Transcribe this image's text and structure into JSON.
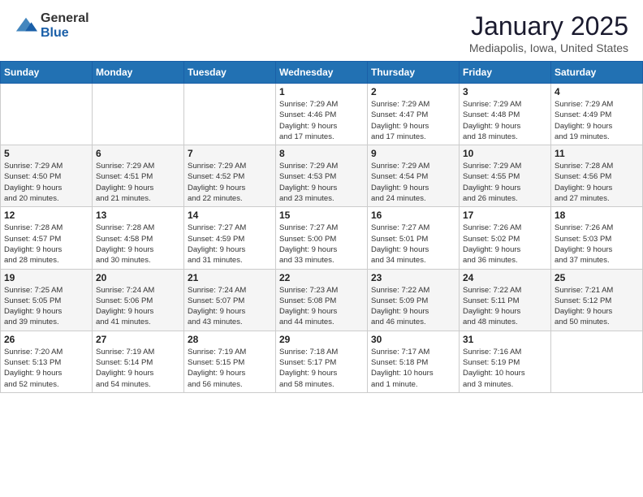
{
  "logo": {
    "general": "General",
    "blue": "Blue"
  },
  "header": {
    "month": "January 2025",
    "location": "Mediapolis, Iowa, United States"
  },
  "weekdays": [
    "Sunday",
    "Monday",
    "Tuesday",
    "Wednesday",
    "Thursday",
    "Friday",
    "Saturday"
  ],
  "weeks": [
    [
      {
        "day": "",
        "info": ""
      },
      {
        "day": "",
        "info": ""
      },
      {
        "day": "",
        "info": ""
      },
      {
        "day": "1",
        "info": "Sunrise: 7:29 AM\nSunset: 4:46 PM\nDaylight: 9 hours\nand 17 minutes."
      },
      {
        "day": "2",
        "info": "Sunrise: 7:29 AM\nSunset: 4:47 PM\nDaylight: 9 hours\nand 17 minutes."
      },
      {
        "day": "3",
        "info": "Sunrise: 7:29 AM\nSunset: 4:48 PM\nDaylight: 9 hours\nand 18 minutes."
      },
      {
        "day": "4",
        "info": "Sunrise: 7:29 AM\nSunset: 4:49 PM\nDaylight: 9 hours\nand 19 minutes."
      }
    ],
    [
      {
        "day": "5",
        "info": "Sunrise: 7:29 AM\nSunset: 4:50 PM\nDaylight: 9 hours\nand 20 minutes."
      },
      {
        "day": "6",
        "info": "Sunrise: 7:29 AM\nSunset: 4:51 PM\nDaylight: 9 hours\nand 21 minutes."
      },
      {
        "day": "7",
        "info": "Sunrise: 7:29 AM\nSunset: 4:52 PM\nDaylight: 9 hours\nand 22 minutes."
      },
      {
        "day": "8",
        "info": "Sunrise: 7:29 AM\nSunset: 4:53 PM\nDaylight: 9 hours\nand 23 minutes."
      },
      {
        "day": "9",
        "info": "Sunrise: 7:29 AM\nSunset: 4:54 PM\nDaylight: 9 hours\nand 24 minutes."
      },
      {
        "day": "10",
        "info": "Sunrise: 7:29 AM\nSunset: 4:55 PM\nDaylight: 9 hours\nand 26 minutes."
      },
      {
        "day": "11",
        "info": "Sunrise: 7:28 AM\nSunset: 4:56 PM\nDaylight: 9 hours\nand 27 minutes."
      }
    ],
    [
      {
        "day": "12",
        "info": "Sunrise: 7:28 AM\nSunset: 4:57 PM\nDaylight: 9 hours\nand 28 minutes."
      },
      {
        "day": "13",
        "info": "Sunrise: 7:28 AM\nSunset: 4:58 PM\nDaylight: 9 hours\nand 30 minutes."
      },
      {
        "day": "14",
        "info": "Sunrise: 7:27 AM\nSunset: 4:59 PM\nDaylight: 9 hours\nand 31 minutes."
      },
      {
        "day": "15",
        "info": "Sunrise: 7:27 AM\nSunset: 5:00 PM\nDaylight: 9 hours\nand 33 minutes."
      },
      {
        "day": "16",
        "info": "Sunrise: 7:27 AM\nSunset: 5:01 PM\nDaylight: 9 hours\nand 34 minutes."
      },
      {
        "day": "17",
        "info": "Sunrise: 7:26 AM\nSunset: 5:02 PM\nDaylight: 9 hours\nand 36 minutes."
      },
      {
        "day": "18",
        "info": "Sunrise: 7:26 AM\nSunset: 5:03 PM\nDaylight: 9 hours\nand 37 minutes."
      }
    ],
    [
      {
        "day": "19",
        "info": "Sunrise: 7:25 AM\nSunset: 5:05 PM\nDaylight: 9 hours\nand 39 minutes."
      },
      {
        "day": "20",
        "info": "Sunrise: 7:24 AM\nSunset: 5:06 PM\nDaylight: 9 hours\nand 41 minutes."
      },
      {
        "day": "21",
        "info": "Sunrise: 7:24 AM\nSunset: 5:07 PM\nDaylight: 9 hours\nand 43 minutes."
      },
      {
        "day": "22",
        "info": "Sunrise: 7:23 AM\nSunset: 5:08 PM\nDaylight: 9 hours\nand 44 minutes."
      },
      {
        "day": "23",
        "info": "Sunrise: 7:22 AM\nSunset: 5:09 PM\nDaylight: 9 hours\nand 46 minutes."
      },
      {
        "day": "24",
        "info": "Sunrise: 7:22 AM\nSunset: 5:11 PM\nDaylight: 9 hours\nand 48 minutes."
      },
      {
        "day": "25",
        "info": "Sunrise: 7:21 AM\nSunset: 5:12 PM\nDaylight: 9 hours\nand 50 minutes."
      }
    ],
    [
      {
        "day": "26",
        "info": "Sunrise: 7:20 AM\nSunset: 5:13 PM\nDaylight: 9 hours\nand 52 minutes."
      },
      {
        "day": "27",
        "info": "Sunrise: 7:19 AM\nSunset: 5:14 PM\nDaylight: 9 hours\nand 54 minutes."
      },
      {
        "day": "28",
        "info": "Sunrise: 7:19 AM\nSunset: 5:15 PM\nDaylight: 9 hours\nand 56 minutes."
      },
      {
        "day": "29",
        "info": "Sunrise: 7:18 AM\nSunset: 5:17 PM\nDaylight: 9 hours\nand 58 minutes."
      },
      {
        "day": "30",
        "info": "Sunrise: 7:17 AM\nSunset: 5:18 PM\nDaylight: 10 hours\nand 1 minute."
      },
      {
        "day": "31",
        "info": "Sunrise: 7:16 AM\nSunset: 5:19 PM\nDaylight: 10 hours\nand 3 minutes."
      },
      {
        "day": "",
        "info": ""
      }
    ]
  ]
}
